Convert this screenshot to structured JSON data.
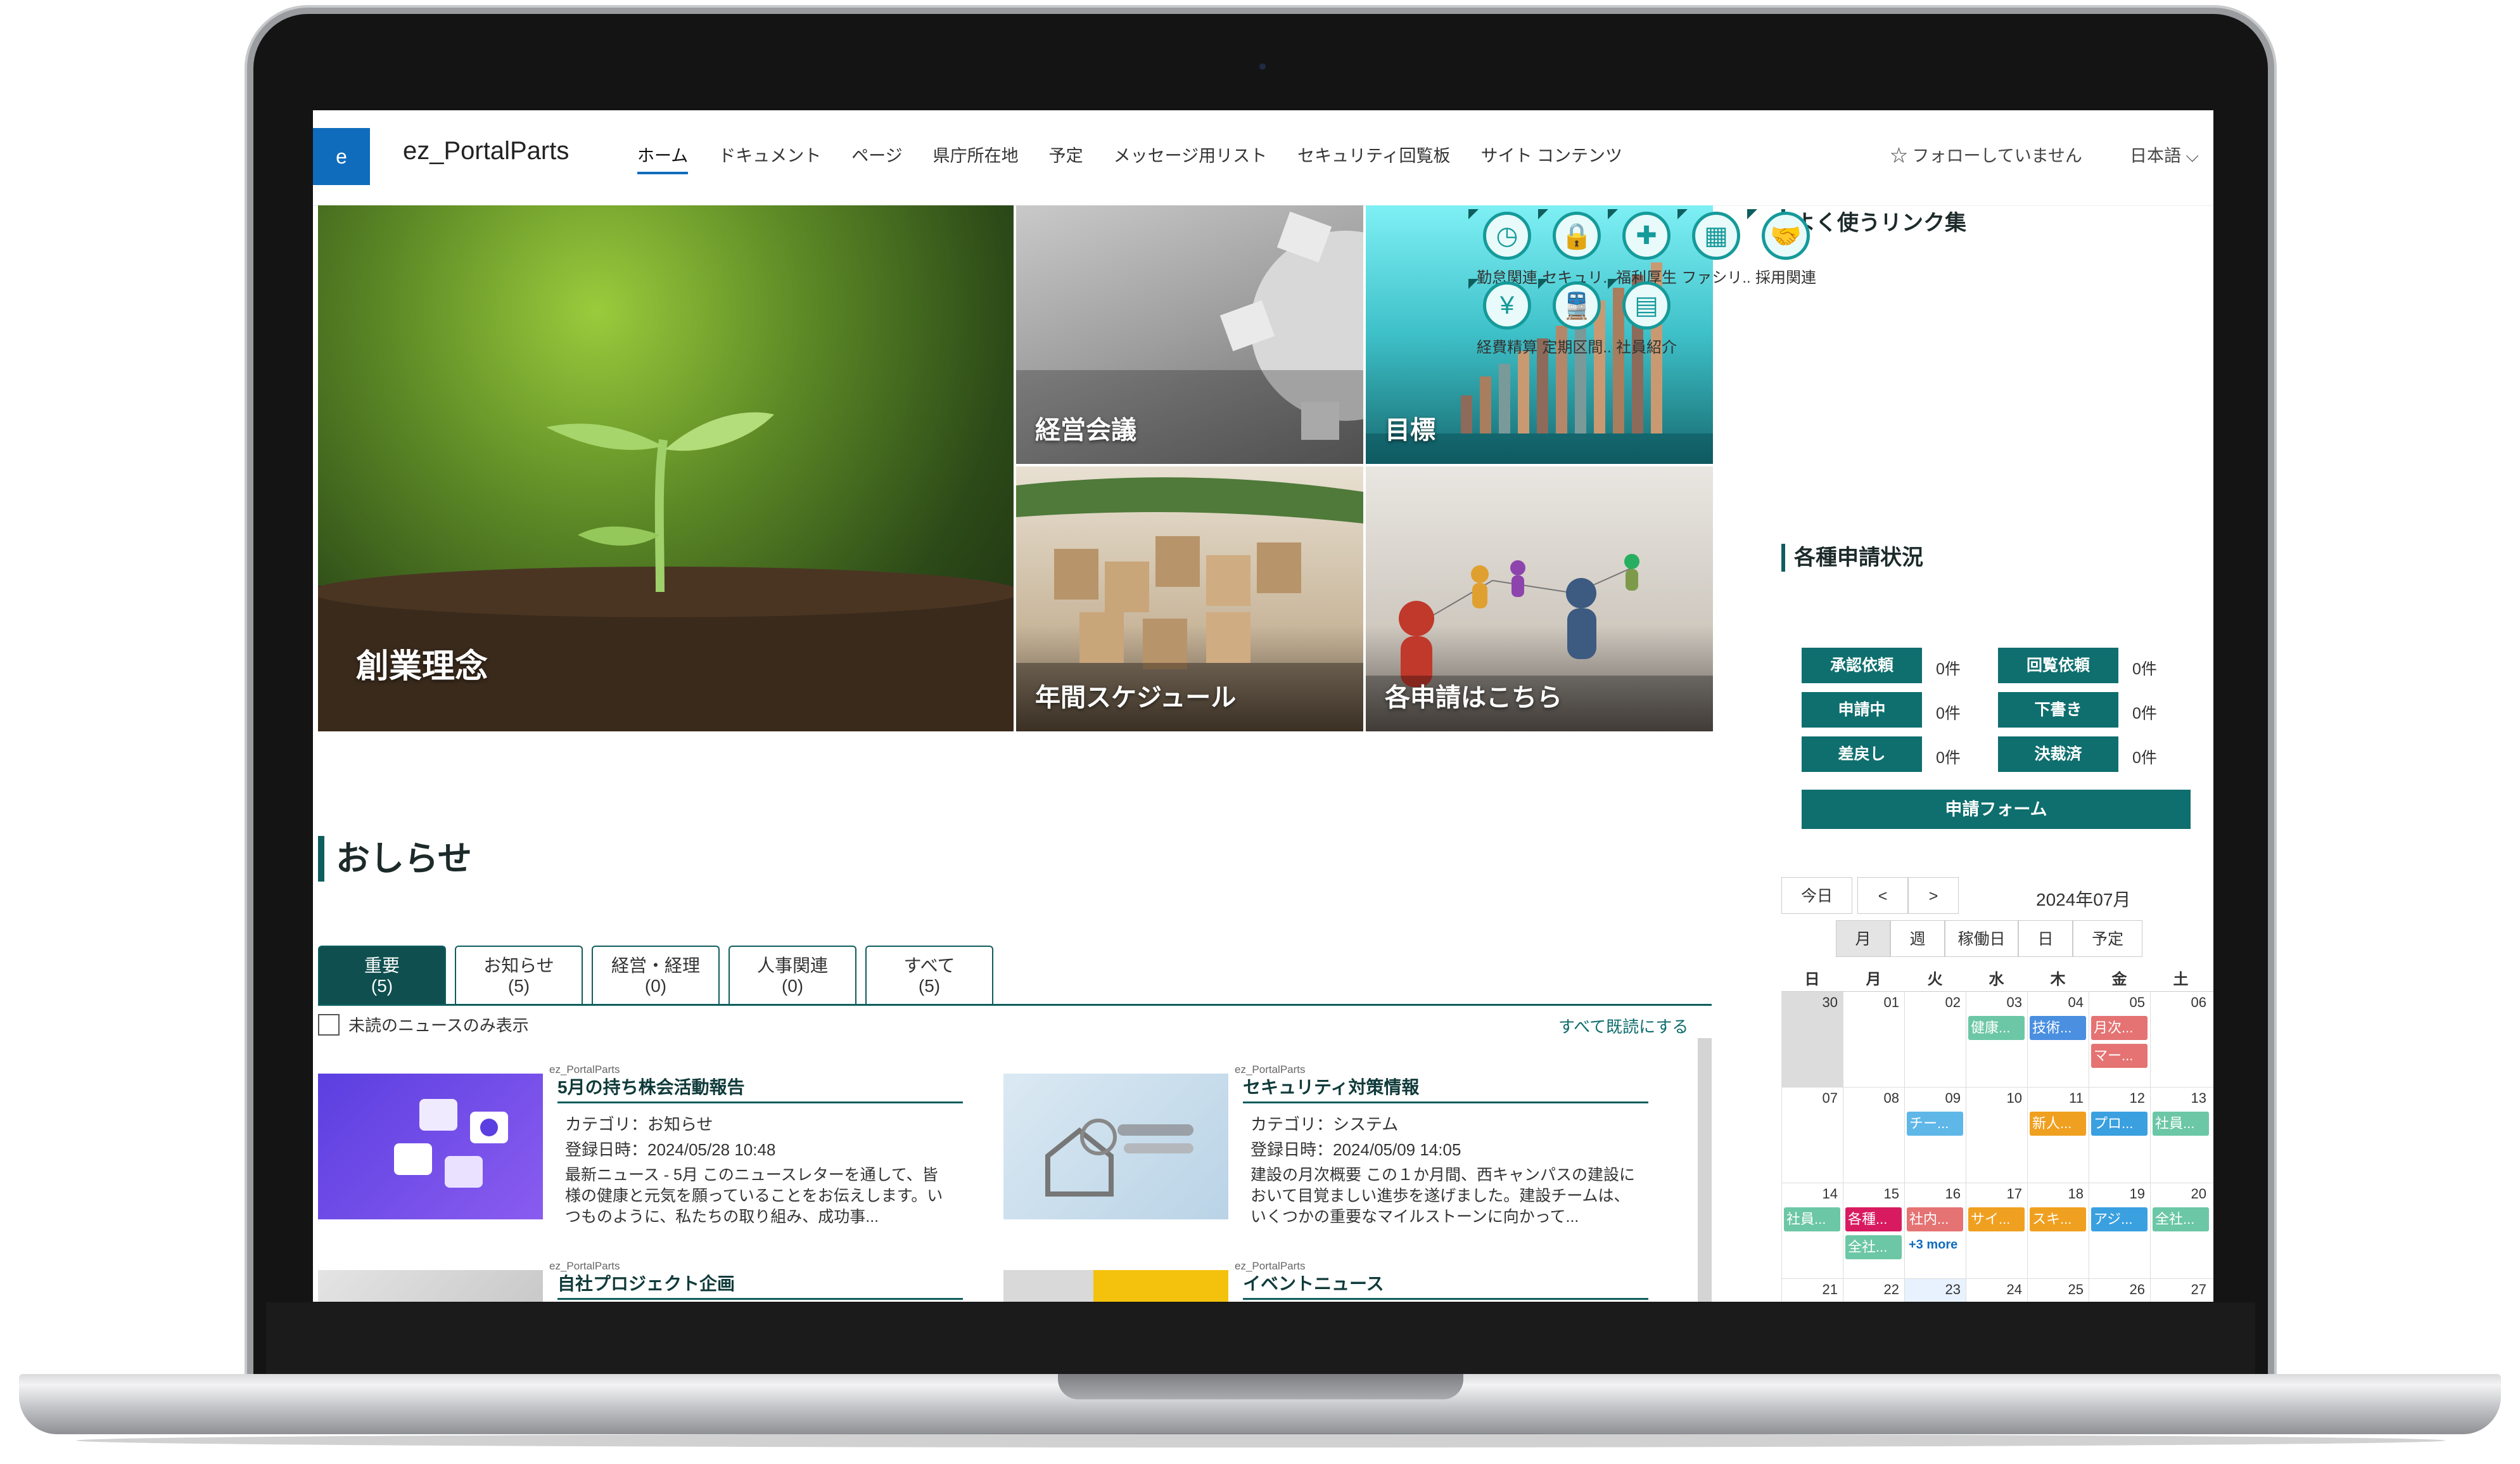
{
  "site": {
    "logo_letter": "e",
    "title": "ez_PortalParts"
  },
  "nav": {
    "items": [
      "ホーム",
      "ドキュメント",
      "ページ",
      "県庁所在地",
      "予定",
      "メッセージ用リスト",
      "セキュリティ回覧板",
      "サイト コンテンツ"
    ],
    "active_index": 0
  },
  "header": {
    "follow": "☆ フォローしていません",
    "language": "日本語 ⌵"
  },
  "hero": {
    "tiles": [
      "創業理念",
      "経営会議",
      "目標",
      "年間スケジュール",
      "各申請はこちら"
    ]
  },
  "news": {
    "title": "おしらせ",
    "tabs": [
      {
        "label": "重要",
        "count": "(5)"
      },
      {
        "label": "お知らせ",
        "count": "(5)"
      },
      {
        "label": "経営・経理",
        "count": "(0)"
      },
      {
        "label": "人事関連",
        "count": "(0)"
      },
      {
        "label": "すべて",
        "count": "(5)"
      }
    ],
    "unread_only": "未読のニュースのみ表示",
    "mark_all_read": "すべて既読にする",
    "cards": [
      {
        "source": "ez_PortalParts",
        "title": "5月の持ち株会活動報告",
        "category": "カテゴリ：お知らせ",
        "date": "登録日時：2024/05/28 10:48",
        "body": "最新ニュース - 5月 このニュースレターを通して、皆様の健康と元気を願っていることをお伝えします。いつものように、私たちの取り組み、成功事..."
      },
      {
        "source": "ez_PortalParts",
        "title": "セキュリティ対策情報",
        "category": "カテゴリ：システム",
        "date": "登録日時：2024/05/09 14:05",
        "body": "建設の月次概要 この１か月間、西キャンパスの建設において目覚ましい進歩を遂げました。建設チームは、いくつかの重要なマイルストーンに向かって..."
      },
      {
        "source": "ez_PortalParts",
        "title": "自社プロジェクト企画"
      },
      {
        "source": "ez_PortalParts",
        "title": "イベントニュース"
      }
    ]
  },
  "links": {
    "title": "よく使うリンク集",
    "items": [
      {
        "label": "勤怠関連",
        "icon": "clock-icon",
        "glyph": "◷"
      },
      {
        "label": "セキュリ..",
        "icon": "lock-icon",
        "glyph": "🔒"
      },
      {
        "label": "福利厚生",
        "icon": "first-aid-icon",
        "glyph": "✚"
      },
      {
        "label": "ファシリ..",
        "icon": "building-icon",
        "glyph": "▦"
      },
      {
        "label": "採用関連",
        "icon": "handshake-icon",
        "glyph": "🤝"
      },
      {
        "label": "経費精算",
        "icon": "money-bag-icon",
        "glyph": "¥"
      },
      {
        "label": "定期区間..",
        "icon": "train-icon",
        "glyph": "🚆"
      },
      {
        "label": "社員紹介",
        "icon": "id-card-icon",
        "glyph": "▤"
      }
    ]
  },
  "status": {
    "title": "各種申請状況",
    "items": [
      {
        "label": "承認依頼",
        "count": "0件"
      },
      {
        "label": "回覧依頼",
        "count": "0件"
      },
      {
        "label": "申請中",
        "count": "0件"
      },
      {
        "label": "下書き",
        "count": "0件"
      },
      {
        "label": "差戻し",
        "count": "0件"
      },
      {
        "label": "決裁済",
        "count": "0件"
      }
    ],
    "form_button": "申請フォーム"
  },
  "calendar": {
    "today": "今日",
    "prev": "<",
    "next": ">",
    "month_label": "2024年07月",
    "views": [
      "月",
      "週",
      "稼働日",
      "日",
      "予定"
    ],
    "selected_view": 0,
    "weekdays": [
      "日",
      "月",
      "火",
      "水",
      "木",
      "金",
      "土"
    ],
    "weeks": [
      {
        "days": [
          "30",
          "01",
          "02",
          "03",
          "04",
          "05",
          "06"
        ]
      },
      {
        "days": [
          "07",
          "08",
          "09",
          "10",
          "11",
          "12",
          "13"
        ]
      },
      {
        "days": [
          "14",
          "15",
          "16",
          "17",
          "18",
          "19",
          "20"
        ]
      },
      {
        "days": [
          "21",
          "22",
          "23",
          "24",
          "25",
          "26",
          "27"
        ]
      }
    ],
    "events": [
      {
        "week": 0,
        "day": 3,
        "row": 0,
        "text": "健康...",
        "color": "#6cc7a6"
      },
      {
        "week": 0,
        "day": 4,
        "row": 0,
        "text": "技術...",
        "color": "#4a8fe0"
      },
      {
        "week": 0,
        "day": 5,
        "row": 0,
        "text": "月次...",
        "color": "#e57373"
      },
      {
        "week": 0,
        "day": 5,
        "row": 1,
        "text": "マー...",
        "color": "#e57373"
      },
      {
        "week": 1,
        "day": 2,
        "row": 0,
        "text": "チー...",
        "color": "#5fb7e8"
      },
      {
        "week": 1,
        "day": 4,
        "row": 0,
        "text": "新人...",
        "color": "#f0a020"
      },
      {
        "week": 1,
        "day": 5,
        "row": 0,
        "text": "プロ...",
        "color": "#3aa0e0"
      },
      {
        "week": 1,
        "day": 6,
        "row": 0,
        "text": "社員...",
        "color": "#6cc7a6"
      },
      {
        "week": 2,
        "day": 0,
        "row": 0,
        "text": "社員...",
        "color": "#6cc7a6"
      },
      {
        "week": 2,
        "day": 1,
        "row": 0,
        "text": "各種...",
        "color": "#d81b60"
      },
      {
        "week": 2,
        "day": 2,
        "row": 0,
        "text": "社内...",
        "color": "#e57373"
      },
      {
        "week": 2,
        "day": 3,
        "row": 0,
        "text": "サイ...",
        "color": "#f0a020"
      },
      {
        "week": 2,
        "day": 4,
        "row": 0,
        "text": "スキ...",
        "color": "#f0a020"
      },
      {
        "week": 2,
        "day": 5,
        "row": 0,
        "text": "アジ...",
        "color": "#3aa0e0"
      },
      {
        "week": 2,
        "day": 6,
        "row": 0,
        "text": "全社...",
        "color": "#6cc7a6"
      },
      {
        "week": 2,
        "day": 1,
        "row": 1,
        "text": "全社...",
        "color": "#6cc7a6"
      }
    ],
    "more": {
      "week": 2,
      "day": 2,
      "text": "+3 more"
    }
  }
}
